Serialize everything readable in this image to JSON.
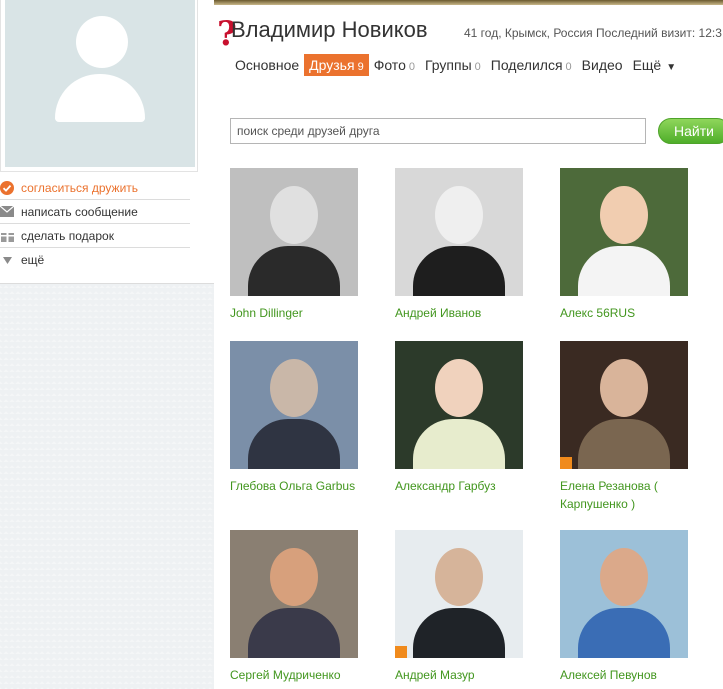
{
  "profile": {
    "name": "Владимир Новиков",
    "meta": "41 год, Крымск, Россия  Последний визит: 12:3"
  },
  "actions": [
    {
      "label": "согласиться дружить",
      "icon": "checkmark-icon",
      "accent": true
    },
    {
      "label": "написать сообщение",
      "icon": "envelope-icon",
      "accent": false
    },
    {
      "label": "сделать подарок",
      "icon": "gift-icon",
      "accent": false
    },
    {
      "label": "ещё",
      "icon": "triangle-down-icon",
      "accent": false
    }
  ],
  "tabs": [
    {
      "label": "Основное",
      "count": ""
    },
    {
      "label": "Друзья",
      "count": "9",
      "active": true
    },
    {
      "label": "Фото",
      "count": "0"
    },
    {
      "label": "Группы",
      "count": "0"
    },
    {
      "label": "Поделился",
      "count": "0"
    },
    {
      "label": "Видео",
      "count": ""
    },
    {
      "label": "Ещё",
      "count": "",
      "arrow": "▼"
    }
  ],
  "search": {
    "placeholder": "поиск среди друзей друга",
    "button": "Найти"
  },
  "friends": [
    {
      "name": "John Dillinger",
      "bg": "#bfbfbf",
      "skin": "#e0e0e0",
      "cloth": "#2a2a2a",
      "badge": false
    },
    {
      "name": "Андрей Иванов",
      "bg": "#d8d8d8",
      "skin": "#efefef",
      "cloth": "#1e1e1e",
      "badge": false
    },
    {
      "name": "Алекс 56RUS",
      "bg": "#4d6a3a",
      "skin": "#f1cdb0",
      "cloth": "#f4f4f4",
      "badge": false
    },
    {
      "name": "Глебова Ольга Garbus",
      "bg": "#7b8fa8",
      "skin": "#c9b7a8",
      "cloth": "#2f3442",
      "badge": false
    },
    {
      "name": "Александр Гарбуз",
      "bg": "#2c3a2a",
      "skin": "#f0d2bd",
      "cloth": "#e7eccd",
      "badge": false
    },
    {
      "name": "Елена Резанова ( Карпушенко )",
      "bg": "#3a2a22",
      "skin": "#d9b49a",
      "cloth": "#7a6650",
      "badge": true
    },
    {
      "name": "Сергей Мудриченко",
      "bg": "#8a7f72",
      "skin": "#d7a07c",
      "cloth": "#3a3a4a",
      "badge": false
    },
    {
      "name": "Андрей Мазур",
      "bg": "#e7ecef",
      "skin": "#d6b49a",
      "cloth": "#1f2328",
      "badge": true
    },
    {
      "name": "Алексей Певунов",
      "bg": "#9cc0d8",
      "skin": "#dba98a",
      "cloth": "#3a6db5",
      "badge": false
    }
  ]
}
